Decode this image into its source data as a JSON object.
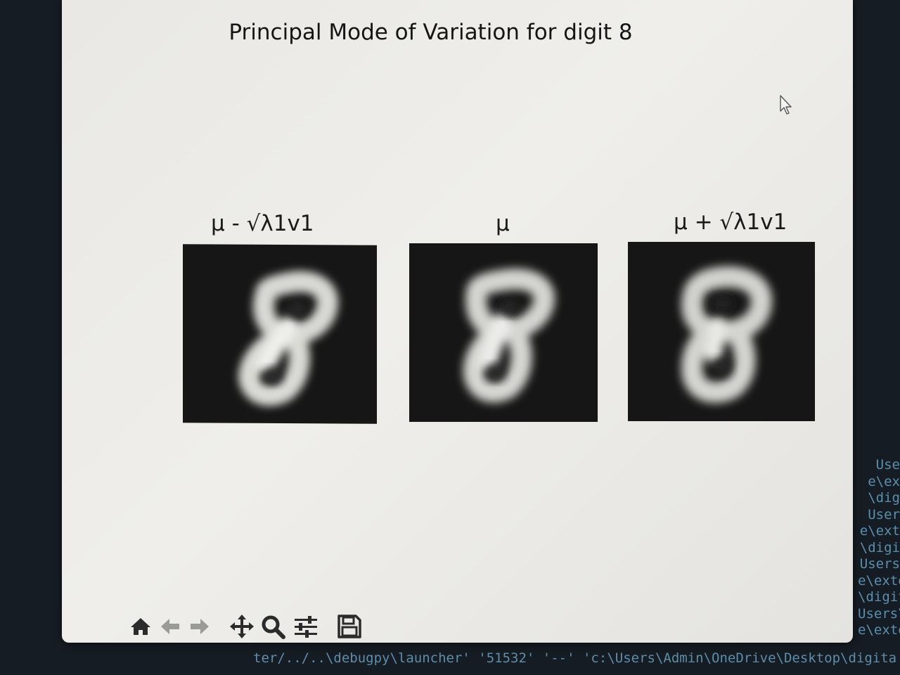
{
  "figure": {
    "title": "Principal Mode of Variation for digit 8"
  },
  "panels": [
    {
      "title": "μ - √λ1v1",
      "image": "digit-8-minus-mode"
    },
    {
      "title": "μ",
      "image": "digit-8-mean"
    },
    {
      "title": "μ + √λ1v1",
      "image": "digit-8-plus-mode"
    }
  ],
  "toolbar": {
    "icons": [
      "home-icon",
      "back-icon",
      "forward-icon",
      "pan-icon",
      "zoom-icon",
      "configure-subplots-icon",
      "save-icon"
    ]
  },
  "terminal": {
    "right_lines": [
      "Use",
      "e\\ex",
      "\\dig",
      "User",
      "e\\ext",
      "\\digi",
      "Users",
      "e\\exte",
      "\\digit",
      "Users\\",
      "e\\exte"
    ],
    "bottom_line": "ter/../..\\debugpy\\launcher' '51532' '--' 'c:\\Users\\Admin\\OneDrive\\Desktop\\digita"
  },
  "colors": {
    "figure_background": "#ecebe7",
    "panel_background": "#161616",
    "toolbar_icon": "#2b2b2b",
    "terminal_text": "#5a8fae"
  }
}
